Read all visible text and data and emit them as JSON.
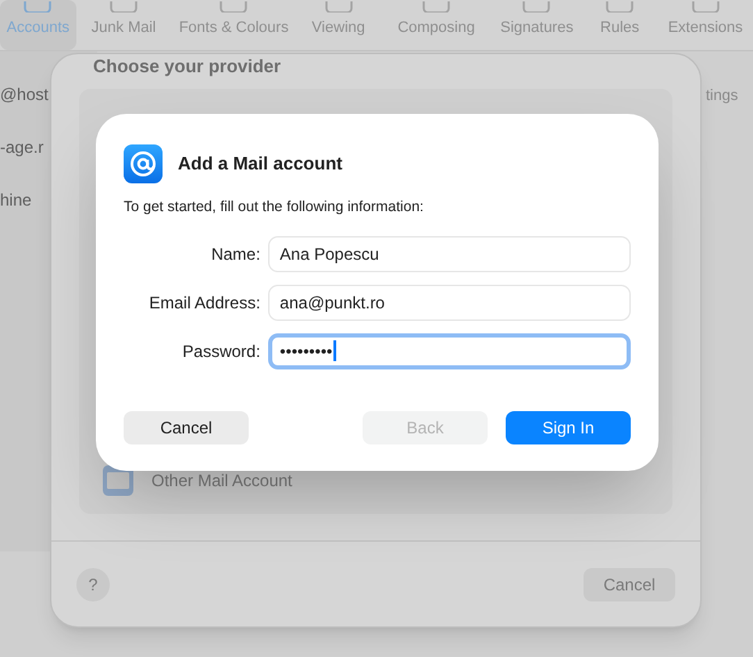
{
  "toolbar": {
    "tabs": [
      {
        "label": "Accounts",
        "selected": true
      },
      {
        "label": "Junk Mail",
        "selected": false
      },
      {
        "label": "Fonts & Colours",
        "selected": false
      },
      {
        "label": "Viewing",
        "selected": false
      },
      {
        "label": "Composing",
        "selected": false
      },
      {
        "label": "Signatures",
        "selected": false
      },
      {
        "label": "Rules",
        "selected": false
      },
      {
        "label": "Extensions",
        "selected": false
      }
    ]
  },
  "sidebar": {
    "items": [
      "@host",
      "-age.r",
      "hine"
    ]
  },
  "detail": {
    "text": "tings"
  },
  "sheet": {
    "title": "Choose your provider",
    "providers": [
      {
        "label": "Other Mail Account"
      }
    ],
    "help": "?",
    "cancel": "Cancel"
  },
  "dialog": {
    "title": "Add a Mail account",
    "subtitle": "To get started, fill out the following information:",
    "fields": [
      {
        "label": "Name:",
        "value": "Ana Popescu",
        "focused": false
      },
      {
        "label": "Email Address:",
        "value": "ana@punkt.ro",
        "focused": false
      },
      {
        "label": "Password:",
        "value": "•••••••••",
        "focused": true
      }
    ],
    "buttons": [
      {
        "label": "Cancel",
        "kind": "secondary",
        "disabled": false
      },
      {
        "label": "Back",
        "kind": "secondary",
        "disabled": true
      },
      {
        "label": "Sign In",
        "kind": "primary",
        "disabled": false
      }
    ]
  }
}
